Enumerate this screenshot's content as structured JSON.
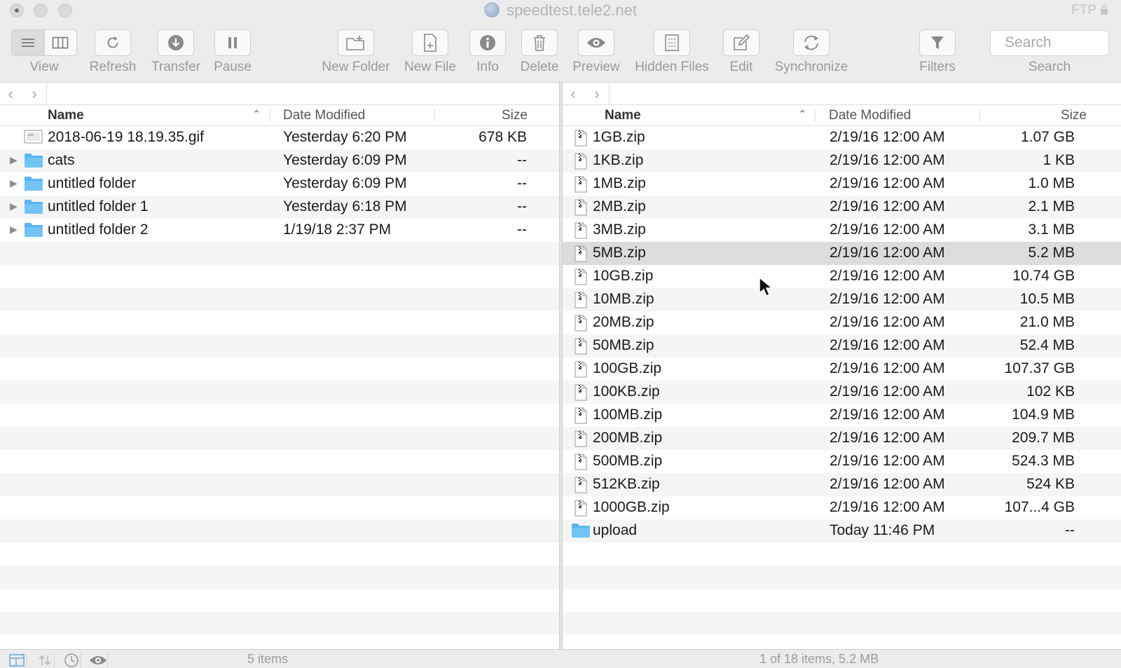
{
  "window": {
    "title": "speedtest.tele2.net",
    "protocol": "FTP"
  },
  "toolbar": {
    "view": "View",
    "refresh": "Refresh",
    "transfer": "Transfer",
    "pause": "Pause",
    "new_folder": "New Folder",
    "new_file": "New File",
    "info": "Info",
    "delete": "Delete",
    "preview": "Preview",
    "hidden_files": "Hidden Files",
    "edit": "Edit",
    "synchronize": "Synchronize",
    "filters": "Filters",
    "search_placeholder": "Search",
    "search_label": "Search"
  },
  "columns": {
    "name": "Name",
    "date": "Date Modified",
    "size": "Size"
  },
  "left_pane": {
    "rows": [
      {
        "name": "2018-06-19 18.19.35.gif",
        "date": "Yesterday 6:20 PM",
        "size": "678 KB",
        "kind": "gif-icon"
      },
      {
        "name": "cats",
        "date": "Yesterday 6:09 PM",
        "size": "--",
        "kind": "folder-icon"
      },
      {
        "name": "untitled folder",
        "date": "Yesterday 6:09 PM",
        "size": "--",
        "kind": "folder-icon"
      },
      {
        "name": "untitled folder 1",
        "date": "Yesterday 6:18 PM",
        "size": "--",
        "kind": "folder-icon"
      },
      {
        "name": "untitled folder 2",
        "date": "1/19/18 2:37 PM",
        "size": "--",
        "kind": "folder-icon"
      }
    ],
    "status": "5 items"
  },
  "right_pane": {
    "selected_index": 5,
    "rows": [
      {
        "name": "1GB.zip",
        "date": "2/19/16 12:00 AM",
        "size": "1.07 GB",
        "kind": "zip-icon"
      },
      {
        "name": "1KB.zip",
        "date": "2/19/16 12:00 AM",
        "size": "1 KB",
        "kind": "zip-icon"
      },
      {
        "name": "1MB.zip",
        "date": "2/19/16 12:00 AM",
        "size": "1.0 MB",
        "kind": "zip-icon"
      },
      {
        "name": "2MB.zip",
        "date": "2/19/16 12:00 AM",
        "size": "2.1 MB",
        "kind": "zip-icon"
      },
      {
        "name": "3MB.zip",
        "date": "2/19/16 12:00 AM",
        "size": "3.1 MB",
        "kind": "zip-icon"
      },
      {
        "name": "5MB.zip",
        "date": "2/19/16 12:00 AM",
        "size": "5.2 MB",
        "kind": "zip-icon"
      },
      {
        "name": "10GB.zip",
        "date": "2/19/16 12:00 AM",
        "size": "10.74 GB",
        "kind": "zip-icon"
      },
      {
        "name": "10MB.zip",
        "date": "2/19/16 12:00 AM",
        "size": "10.5 MB",
        "kind": "zip-icon"
      },
      {
        "name": "20MB.zip",
        "date": "2/19/16 12:00 AM",
        "size": "21.0 MB",
        "kind": "zip-icon"
      },
      {
        "name": "50MB.zip",
        "date": "2/19/16 12:00 AM",
        "size": "52.4 MB",
        "kind": "zip-icon"
      },
      {
        "name": "100GB.zip",
        "date": "2/19/16 12:00 AM",
        "size": "107.37 GB",
        "kind": "zip-icon"
      },
      {
        "name": "100KB.zip",
        "date": "2/19/16 12:00 AM",
        "size": "102 KB",
        "kind": "zip-icon"
      },
      {
        "name": "100MB.zip",
        "date": "2/19/16 12:00 AM",
        "size": "104.9 MB",
        "kind": "zip-icon"
      },
      {
        "name": "200MB.zip",
        "date": "2/19/16 12:00 AM",
        "size": "209.7 MB",
        "kind": "zip-icon"
      },
      {
        "name": "500MB.zip",
        "date": "2/19/16 12:00 AM",
        "size": "524.3 MB",
        "kind": "zip-icon"
      },
      {
        "name": "512KB.zip",
        "date": "2/19/16 12:00 AM",
        "size": "524 KB",
        "kind": "zip-icon"
      },
      {
        "name": "1000GB.zip",
        "date": "2/19/16 12:00 AM",
        "size": "107...4 GB",
        "kind": "zip-icon"
      },
      {
        "name": "upload",
        "date": "Today 11:46 PM",
        "size": "--",
        "kind": "folder-icon"
      }
    ],
    "status": "1 of 18 items, 5.2 MB"
  },
  "colors": {
    "folder": "#5ab4f0",
    "selection": "#dcdcdc",
    "stripe": "#f4f5f5"
  }
}
